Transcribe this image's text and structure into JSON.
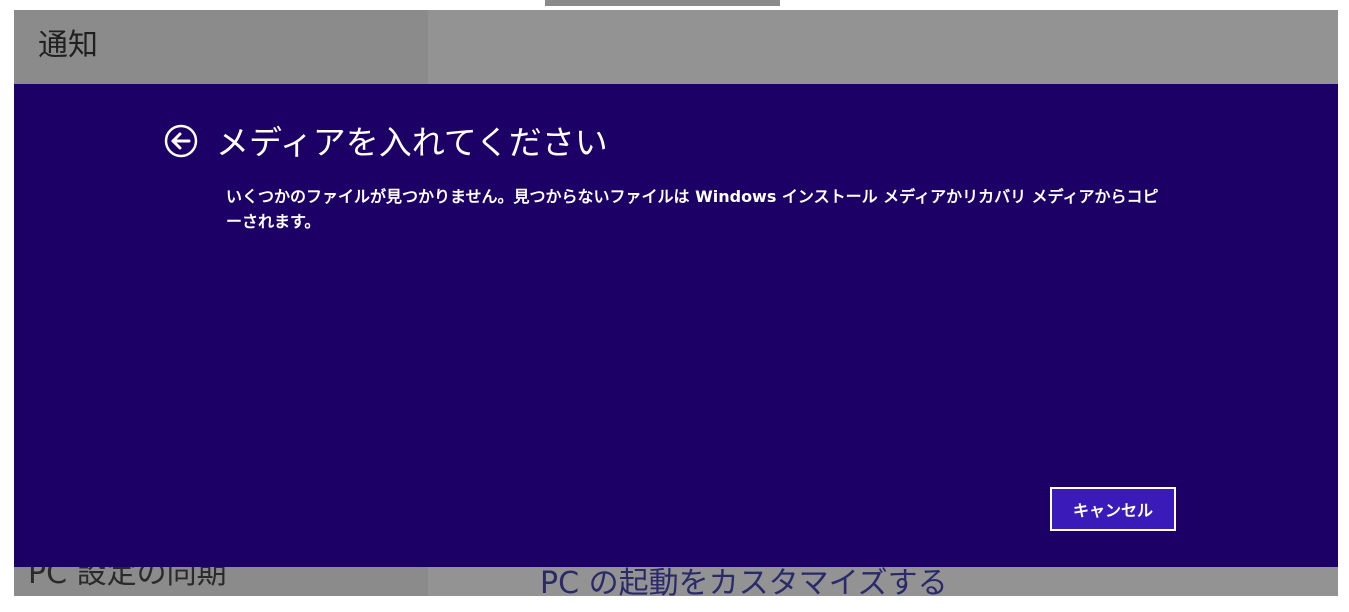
{
  "background": {
    "title": "通知",
    "left_item": "PC 設定の同期",
    "right_item": "PC の起動をカスタマイズする"
  },
  "dialog": {
    "back_icon": "arrow-left-circle-icon",
    "title": "メディアを入れてください",
    "message": "いくつかのファイルが見つかりません。見つからないファイルは Windows インストール メディアかリカバリ メディアからコピーされます。",
    "cancel_label": "キャンセル"
  },
  "colors": {
    "dialog_bg": "#1d0066",
    "button_bg": "#3a1ab8",
    "text": "#ffffff",
    "overlay": "#8e8e8e"
  }
}
